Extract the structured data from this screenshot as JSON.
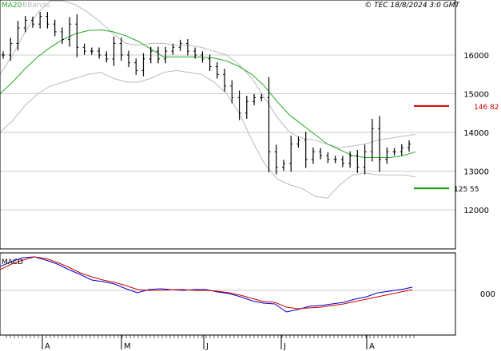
{
  "header": {
    "indicator_labels": [
      "MA20",
      "BBands"
    ],
    "copyright": "© TEC 18/8/2024 3:0 GMT"
  },
  "colors": {
    "price_bars": "#000000",
    "ma20": "#22aa22",
    "bbands": "#bbbbbb",
    "grid": "#cccccc",
    "resistance": "#cc0000",
    "support": "#009900",
    "macd": "#0000cc",
    "signal": "#cc0000",
    "frame": "#000000"
  },
  "chart_data": [
    {
      "type": "line",
      "panel": "price",
      "x_ticks": [
        "A",
        "M",
        "J",
        "J",
        "A"
      ],
      "y_ticks": [
        12000,
        13000,
        14000,
        15000,
        16000
      ],
      "ylim": [
        11000,
        17400
      ],
      "grid": true,
      "levels": [
        {
          "name": "resistance",
          "value": 14682,
          "label": "146 82"
        },
        {
          "name": "support",
          "value": 12555,
          "label": "125 55"
        }
      ],
      "series": [
        {
          "name": "MA20",
          "values": [
            15000,
            15300,
            15650,
            15950,
            16200,
            16400,
            16550,
            16630,
            16650,
            16600,
            16500,
            16350,
            16150,
            15950,
            15950,
            15950,
            15950,
            15920,
            15850,
            15700,
            15500,
            15200,
            14800,
            14450,
            14200,
            13950,
            13700,
            13550,
            13400,
            13350,
            13350,
            13350,
            13400,
            13500
          ]
        },
        {
          "name": "BBands upper",
          "values": [
            15500,
            16000,
            16600,
            17100,
            17400,
            17400,
            17300,
            17100,
            16850,
            16550,
            16300,
            16250,
            16300,
            16300,
            16250,
            16250,
            16200,
            16100,
            16000,
            15750,
            15400,
            14900,
            14400,
            14000,
            13850,
            13800,
            13700,
            13600,
            13650,
            13700,
            13800,
            13850,
            13900,
            13950
          ]
        },
        {
          "name": "BBands lower",
          "values": [
            14000,
            14300,
            14700,
            15000,
            15200,
            15300,
            15400,
            15500,
            15550,
            15400,
            15300,
            15300,
            15400,
            15550,
            15600,
            15550,
            15500,
            15300,
            15000,
            14500,
            13800,
            13200,
            12800,
            12650,
            12550,
            12350,
            12300,
            12650,
            12900,
            12950,
            12900,
            12900,
            12900,
            12850
          ]
        }
      ],
      "ohlc_close": [
        16000,
        16300,
        16700,
        16900,
        16800,
        17000,
        16800,
        16600,
        16400,
        16800,
        16200,
        16100,
        16100,
        16000,
        15900,
        16300,
        16000,
        15800,
        15600,
        15900,
        16100,
        15900,
        16100,
        16200,
        16300,
        16100,
        16000,
        15900,
        15700,
        15500,
        15200,
        14900,
        14500,
        14800,
        14900,
        14900,
        13500,
        13100,
        13200,
        13700,
        13800,
        13300,
        13500,
        13400,
        13300,
        13300,
        13200,
        13400,
        13100,
        13500,
        14100,
        13300,
        13500,
        13500,
        13600,
        13700
      ]
    },
    {
      "type": "line",
      "panel": "macd",
      "label": "MACD",
      "y_ticks": [
        0
      ],
      "y_tick_labels": [
        "000"
      ],
      "series": [
        {
          "name": "MACD",
          "values": [
            300,
            360,
            410,
            420,
            380,
            330,
            260,
            200,
            130,
            110,
            80,
            20,
            -30,
            10,
            20,
            10,
            0,
            10,
            10,
            -20,
            -40,
            -80,
            -130,
            -160,
            -170,
            -270,
            -240,
            -200,
            -190,
            -170,
            -150,
            -110,
            -80,
            -30,
            -10,
            10,
            40
          ]
        },
        {
          "name": "Signal",
          "values": [
            260,
            330,
            380,
            420,
            400,
            350,
            290,
            220,
            170,
            130,
            100,
            60,
            10,
            0,
            0,
            10,
            10,
            0,
            0,
            -10,
            -30,
            -60,
            -100,
            -140,
            -150,
            -210,
            -230,
            -220,
            -210,
            -190,
            -170,
            -140,
            -110,
            -80,
            -50,
            -20,
            10
          ]
        }
      ]
    }
  ]
}
